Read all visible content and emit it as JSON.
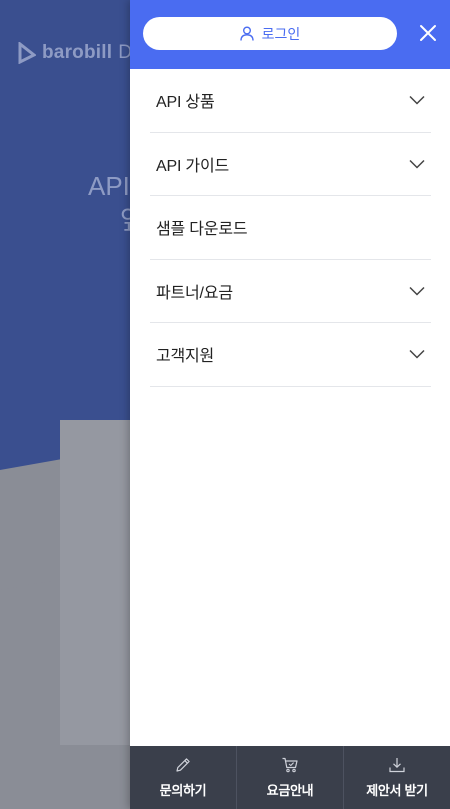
{
  "background": {
    "logo_text": "barobill",
    "logo_suffix": "D",
    "hero_line1": "API",
    "hero_line2": "앞"
  },
  "drawer": {
    "login_label": "로그인",
    "menu": [
      {
        "label": "API 상품",
        "has_children": true
      },
      {
        "label": "API 가이드",
        "has_children": true
      },
      {
        "label": "샘플 다운로드",
        "has_children": false
      },
      {
        "label": "파트너/요금",
        "has_children": true
      },
      {
        "label": "고객지원",
        "has_children": true
      }
    ],
    "bottom": [
      {
        "label": "문의하기",
        "icon": "pencil-icon"
      },
      {
        "label": "요금안내",
        "icon": "cart-icon"
      },
      {
        "label": "제안서 받기",
        "icon": "download-icon"
      }
    ]
  },
  "colors": {
    "accent": "#4a6cf1",
    "bottom_bar": "#3a3f4b",
    "hero_bg": "#3a4f8f"
  }
}
